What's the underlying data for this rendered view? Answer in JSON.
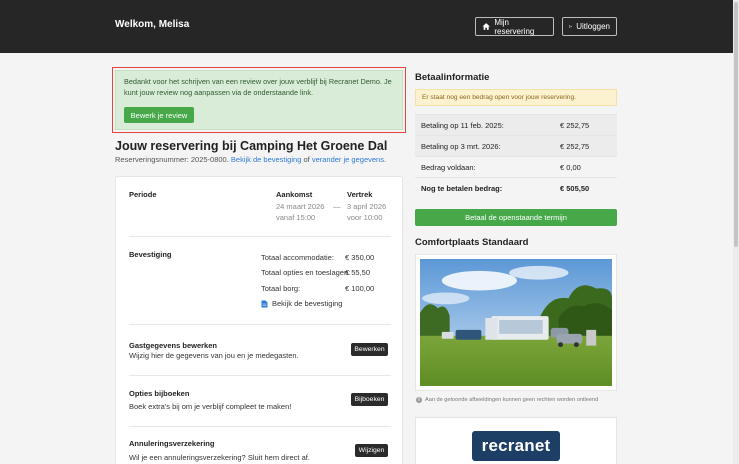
{
  "header": {
    "welcome": "Welkom, Melisa",
    "my_reservation_label": "Mijn reservering",
    "logout_label": "Uitloggen"
  },
  "alert": {
    "message": "Bedankt voor het schrijven van een review over jouw verblijf bij Recranet Demo. Je kunt jouw review nog aanpassen via de onderstaande link.",
    "button_label": "Bewerk je review"
  },
  "reservation": {
    "title": "Jouw reservering bij Camping Het Groene Dal",
    "number_prefix": "Reserveringsnummer: 2025-0800.",
    "confirmation_link": "Bekijk de bevestiging",
    "or_text": "of",
    "change_link": "verander je gegevens",
    "period_label": "Periode",
    "arrival_label": "Aankomst",
    "arrival_date": "24 maart 2026",
    "arrival_time": "vanaf 15:00",
    "dash": "—",
    "departure_label": "Vertrek",
    "departure_date": "3 april 2026",
    "departure_time": "voor 10:00",
    "confirmation_label": "Bevestiging",
    "totals": [
      {
        "label": "Totaal accommodatie:",
        "value": "€ 350,00"
      },
      {
        "label": "Totaal opties en toeslagen:",
        "value": "€ 55,50"
      },
      {
        "label": "Totaal borg:",
        "value": "€ 100,00"
      }
    ],
    "view_confirmation": "Bekijk de bevestiging",
    "guest_title": "Gastgegevens bewerken",
    "guest_text": "Wijzig hier de gegevens van jou en je medegasten.",
    "guest_button": "Bewerken",
    "options_title": "Opties bijboeken",
    "options_text": "Boek extra's bij om je verblijf compleet te maken!",
    "options_button": "Bijboeken",
    "insurance_title": "Annuleringsverzekering",
    "insurance_text": "Wil je een annuleringsverzekering? Sluit hem direct af.",
    "insurance_button": "Wijzigen"
  },
  "payment": {
    "title": "Betaalinformatie",
    "notice": "Er staat nog een bedrag open voor jouw reservering.",
    "rows": [
      {
        "label": "Betaling op 11 feb. 2025:",
        "value": "€ 252,75"
      },
      {
        "label": "Betaling op 3 mrt. 2026:",
        "value": "€ 252,75"
      },
      {
        "label": "Bedrag voldaan:",
        "value": "€ 0,00"
      },
      {
        "label": "Nog te betalen bedrag:",
        "value": "€ 505,50"
      }
    ],
    "pay_button": "Betaal de openstaande termijn"
  },
  "accommodation": {
    "title": "Comfortplaats Standaard",
    "disclaimer": "Aan de getoonde afbeeldingen kunnen geen rechten worden ontleend",
    "logo_text": "recranet"
  },
  "colors": {
    "topbar": "#262626",
    "green": "#47a84a",
    "link": "#2f7ad6",
    "alert_bg": "#d9ecd8",
    "highlight": "#e2453a",
    "brand": "#1d3f66"
  },
  "icons": [
    "home-icon",
    "logout-icon",
    "document-icon",
    "info-icon"
  ]
}
